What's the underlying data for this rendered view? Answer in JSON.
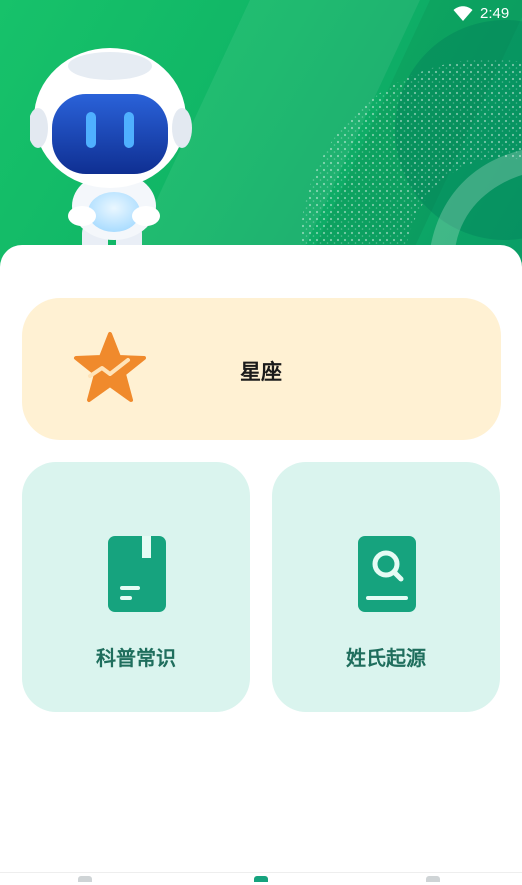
{
  "status_bar": {
    "time": "2:49",
    "wifi_icon": "wifi-icon"
  },
  "hero": {
    "mascot": "robot-mascot"
  },
  "cards": {
    "constellation": {
      "label": "星座",
      "icon": "star-icon"
    },
    "science": {
      "label": "科普常识",
      "icon": "book-bookmark-icon"
    },
    "surname": {
      "label": "姓氏起源",
      "icon": "book-search-icon"
    }
  },
  "colors": {
    "hero_green": "#13bb68",
    "star_card_bg": "#fff1d3",
    "mint_card_bg": "#daf4ee",
    "accent_teal": "#16a37e",
    "label_teal": "#1f6e5d",
    "star_orange": "#f08a2c"
  }
}
